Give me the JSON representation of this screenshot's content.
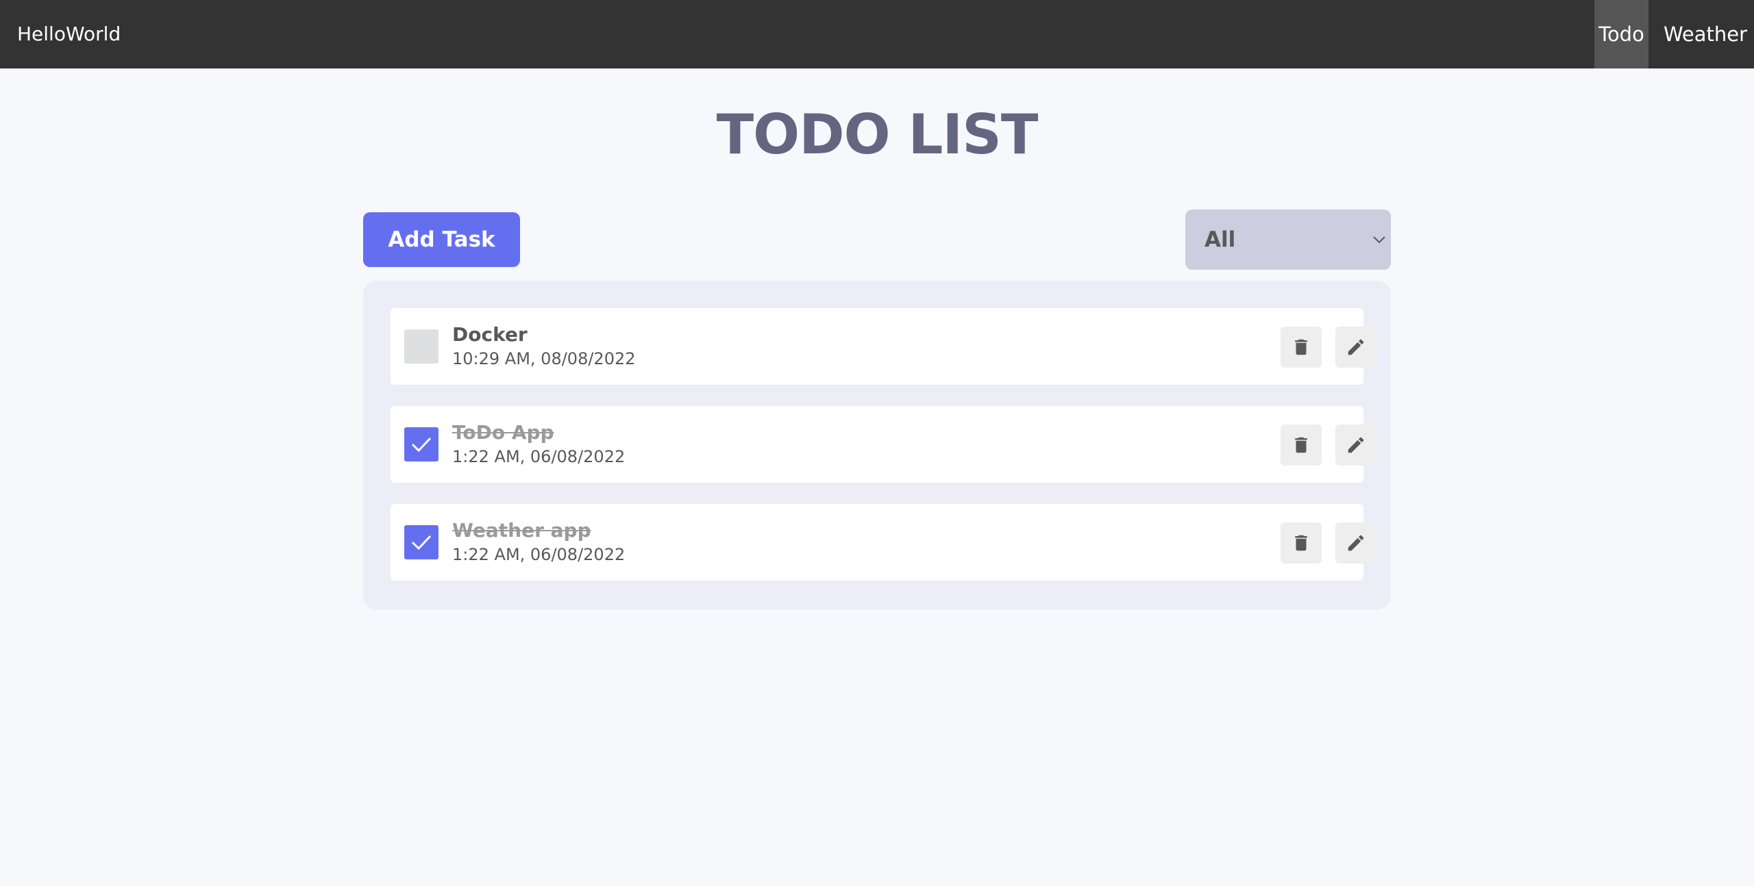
{
  "navbar": {
    "brand": "HelloWorld",
    "links": [
      {
        "label": "Todo",
        "active": true
      },
      {
        "label": "Weather",
        "active": false
      }
    ]
  },
  "page": {
    "title": "TODO LIST"
  },
  "toolbar": {
    "add_label": "Add Task",
    "filter": {
      "selected": "All"
    }
  },
  "tasks": [
    {
      "title": "Docker",
      "time": "10:29 AM, 08/08/2022",
      "completed": false
    },
    {
      "title": "ToDo App",
      "time": "1:22 AM, 06/08/2022",
      "completed": true
    },
    {
      "title": "Weather app",
      "time": "1:22 AM, 06/08/2022",
      "completed": true
    }
  ],
  "colors": {
    "accent": "#646ff0",
    "navbar": "#333333",
    "title": "#646681",
    "panel": "#ecedf6",
    "filter": "#cccdde",
    "background": "#f7f8fc"
  },
  "icons": {
    "delete": "trash-icon",
    "edit": "pencil-icon",
    "check": "check-icon",
    "dropdown": "chevron-down-icon"
  }
}
